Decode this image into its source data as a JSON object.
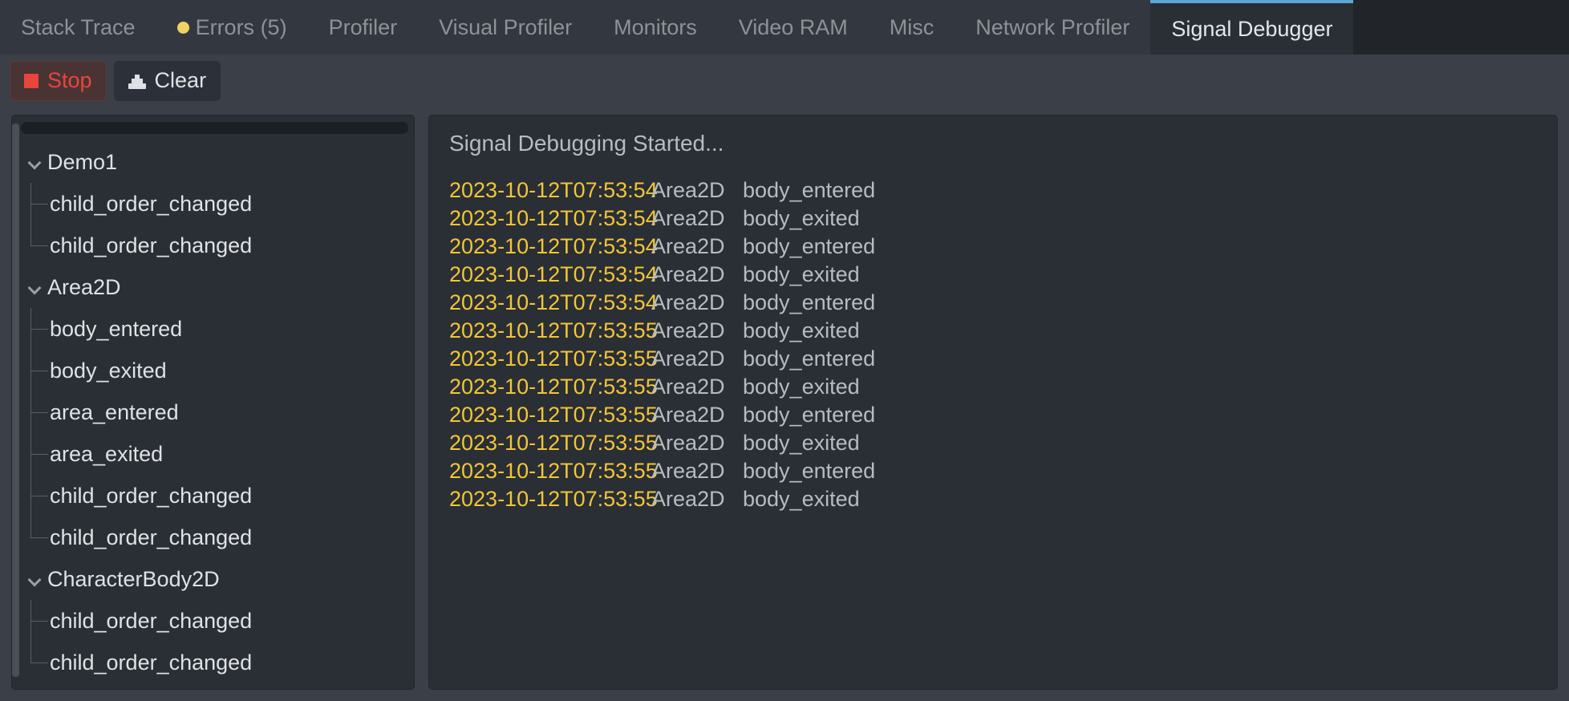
{
  "tabs": [
    {
      "label": "Stack Trace",
      "active": false,
      "dot": false
    },
    {
      "label": "Errors (5)",
      "active": false,
      "dot": true
    },
    {
      "label": "Profiler",
      "active": false,
      "dot": false
    },
    {
      "label": "Visual Profiler",
      "active": false,
      "dot": false
    },
    {
      "label": "Monitors",
      "active": false,
      "dot": false
    },
    {
      "label": "Video RAM",
      "active": false,
      "dot": false
    },
    {
      "label": "Misc",
      "active": false,
      "dot": false
    },
    {
      "label": "Network Profiler",
      "active": false,
      "dot": false
    },
    {
      "label": "Signal Debugger",
      "active": true,
      "dot": false
    }
  ],
  "toolbar": {
    "stop_label": "Stop",
    "clear_label": "Clear"
  },
  "tree": [
    {
      "label": "Demo1",
      "type": "root"
    },
    {
      "label": "child_order_changed",
      "type": "child"
    },
    {
      "label": "child_order_changed",
      "type": "child",
      "last": true
    },
    {
      "label": "Area2D",
      "type": "root"
    },
    {
      "label": "body_entered",
      "type": "child"
    },
    {
      "label": "body_exited",
      "type": "child"
    },
    {
      "label": "area_entered",
      "type": "child"
    },
    {
      "label": "area_exited",
      "type": "child"
    },
    {
      "label": "child_order_changed",
      "type": "child"
    },
    {
      "label": "child_order_changed",
      "type": "child",
      "last": true
    },
    {
      "label": "CharacterBody2D",
      "type": "root"
    },
    {
      "label": "child_order_changed",
      "type": "child"
    },
    {
      "label": "child_order_changed",
      "type": "child",
      "last": true
    }
  ],
  "log": {
    "title": "Signal Debugging Started...",
    "rows": [
      {
        "time": "2023-10-12T07:53:54",
        "node": "Area2D",
        "signal": "body_entered"
      },
      {
        "time": "2023-10-12T07:53:54",
        "node": "Area2D",
        "signal": "body_exited"
      },
      {
        "time": "2023-10-12T07:53:54",
        "node": "Area2D",
        "signal": "body_entered"
      },
      {
        "time": "2023-10-12T07:53:54",
        "node": "Area2D",
        "signal": "body_exited"
      },
      {
        "time": "2023-10-12T07:53:54",
        "node": "Area2D",
        "signal": "body_entered"
      },
      {
        "time": "2023-10-12T07:53:55",
        "node": "Area2D",
        "signal": "body_exited"
      },
      {
        "time": "2023-10-12T07:53:55",
        "node": "Area2D",
        "signal": "body_entered"
      },
      {
        "time": "2023-10-12T07:53:55",
        "node": "Area2D",
        "signal": "body_exited"
      },
      {
        "time": "2023-10-12T07:53:55",
        "node": "Area2D",
        "signal": "body_entered"
      },
      {
        "time": "2023-10-12T07:53:55",
        "node": "Area2D",
        "signal": "body_exited"
      },
      {
        "time": "2023-10-12T07:53:55",
        "node": "Area2D",
        "signal": "body_entered"
      },
      {
        "time": "2023-10-12T07:53:55",
        "node": "Area2D",
        "signal": "body_exited"
      }
    ]
  },
  "colors": {
    "accent": "#5ba8d6",
    "timestamp": "#f2c636",
    "stop": "#e8453c",
    "error_dot": "#f0d264"
  }
}
